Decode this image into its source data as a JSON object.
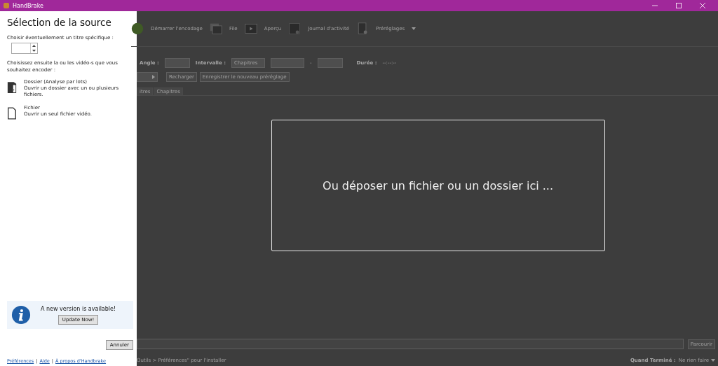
{
  "window": {
    "title": "HandBrake"
  },
  "source_panel": {
    "title": "Sélection de la source",
    "title_label": "Choisir éventuellement un titre spécifique :",
    "list_label": "Choisissez ensuite la ou les vidéo-s que vous souhaitez encoder :",
    "options": [
      {
        "kind": "folder",
        "title": "Dossier (Analyse par lots)",
        "description": "Ouvrir un dossier avec un ou plusieurs fichiers."
      },
      {
        "kind": "file",
        "title": "Fichier",
        "description": "Ouvrir un seul fichier vidéo."
      }
    ],
    "update": {
      "message": "A new version is available!",
      "button": "Update Now!"
    },
    "cancel_button": "Annuler",
    "links": [
      "Préférences",
      "Aide",
      "À propos d'Handbrake"
    ],
    "separator": "|"
  },
  "toolbar": [
    {
      "kind": "start",
      "label": "Démarrer l'encodage"
    },
    {
      "kind": "queue",
      "label": "File"
    },
    {
      "kind": "preview",
      "label": "Aperçu"
    },
    {
      "kind": "log",
      "label": "Journal d'activité"
    },
    {
      "kind": "presets",
      "label": "Préréglages"
    }
  ],
  "source_row": {
    "angle_label": "Angle :",
    "range_label": "Intervalle :",
    "range_value": "Chapitres",
    "range_dash": "-",
    "duration_label": "Durée :",
    "duration_value": "--:--:--"
  },
  "preset_buttons": [
    "Recharger",
    "Enregistrer le nouveau préréglage"
  ],
  "tabs": [
    "itres",
    "Chapitres"
  ],
  "drop_zone": {
    "text": "Ou déposer un fichier ou un dossier ici ..."
  },
  "destination": {
    "browse_button": "Parcourir"
  },
  "status_bar": {
    "message": "Outils > Préférences\" pour l'installer",
    "when_done_label": "Quand Terminé :",
    "when_done_value": "Ne rien faire"
  }
}
